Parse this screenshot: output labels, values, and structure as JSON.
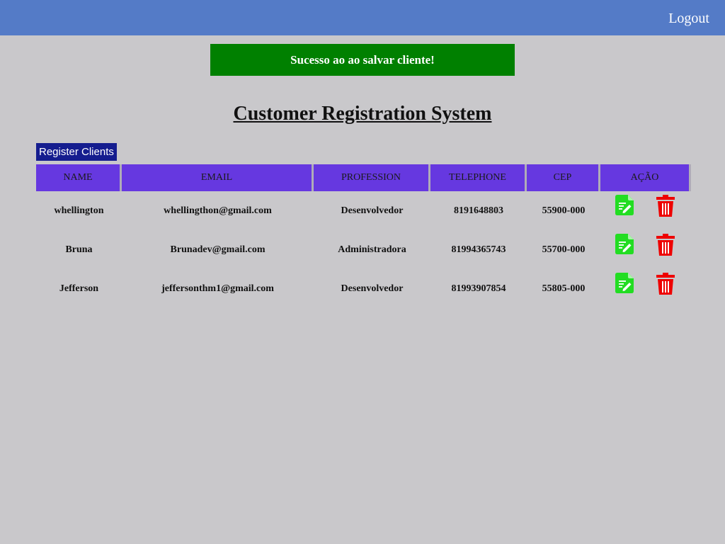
{
  "header": {
    "logout_label": "Logout",
    "background_color": "#547bc7"
  },
  "alert": {
    "message": "Sucesso ao ao salvar cliente!",
    "color": "#008000"
  },
  "page": {
    "title": "Customer Registration System"
  },
  "toolbar": {
    "register_label": "Register Clients"
  },
  "table": {
    "columns": [
      "NAME",
      "EMAIL",
      "PROFESSION",
      "TELEPHONE",
      "CEP",
      "AÇÃO"
    ],
    "header_color": "#6638e0",
    "rows": [
      {
        "name": "whellington",
        "email": "whellingthon@gmail.com",
        "profession": "Desenvolvedor",
        "telephone": "8191648803",
        "cep": "55900-000"
      },
      {
        "name": "Bruna",
        "email": "Brunadev@gmail.com",
        "profession": "Administradora",
        "telephone": "81994365743",
        "cep": "55700-000"
      },
      {
        "name": "Jefferson",
        "email": "jeffersonthm1@gmail.com",
        "profession": "Desenvolvedor",
        "telephone": "81993907854",
        "cep": "55805-000"
      }
    ],
    "action_icons": {
      "edit": "edit-icon",
      "delete": "trash-icon"
    },
    "edit_color": "#22dd22",
    "delete_color": "#ee0000"
  }
}
